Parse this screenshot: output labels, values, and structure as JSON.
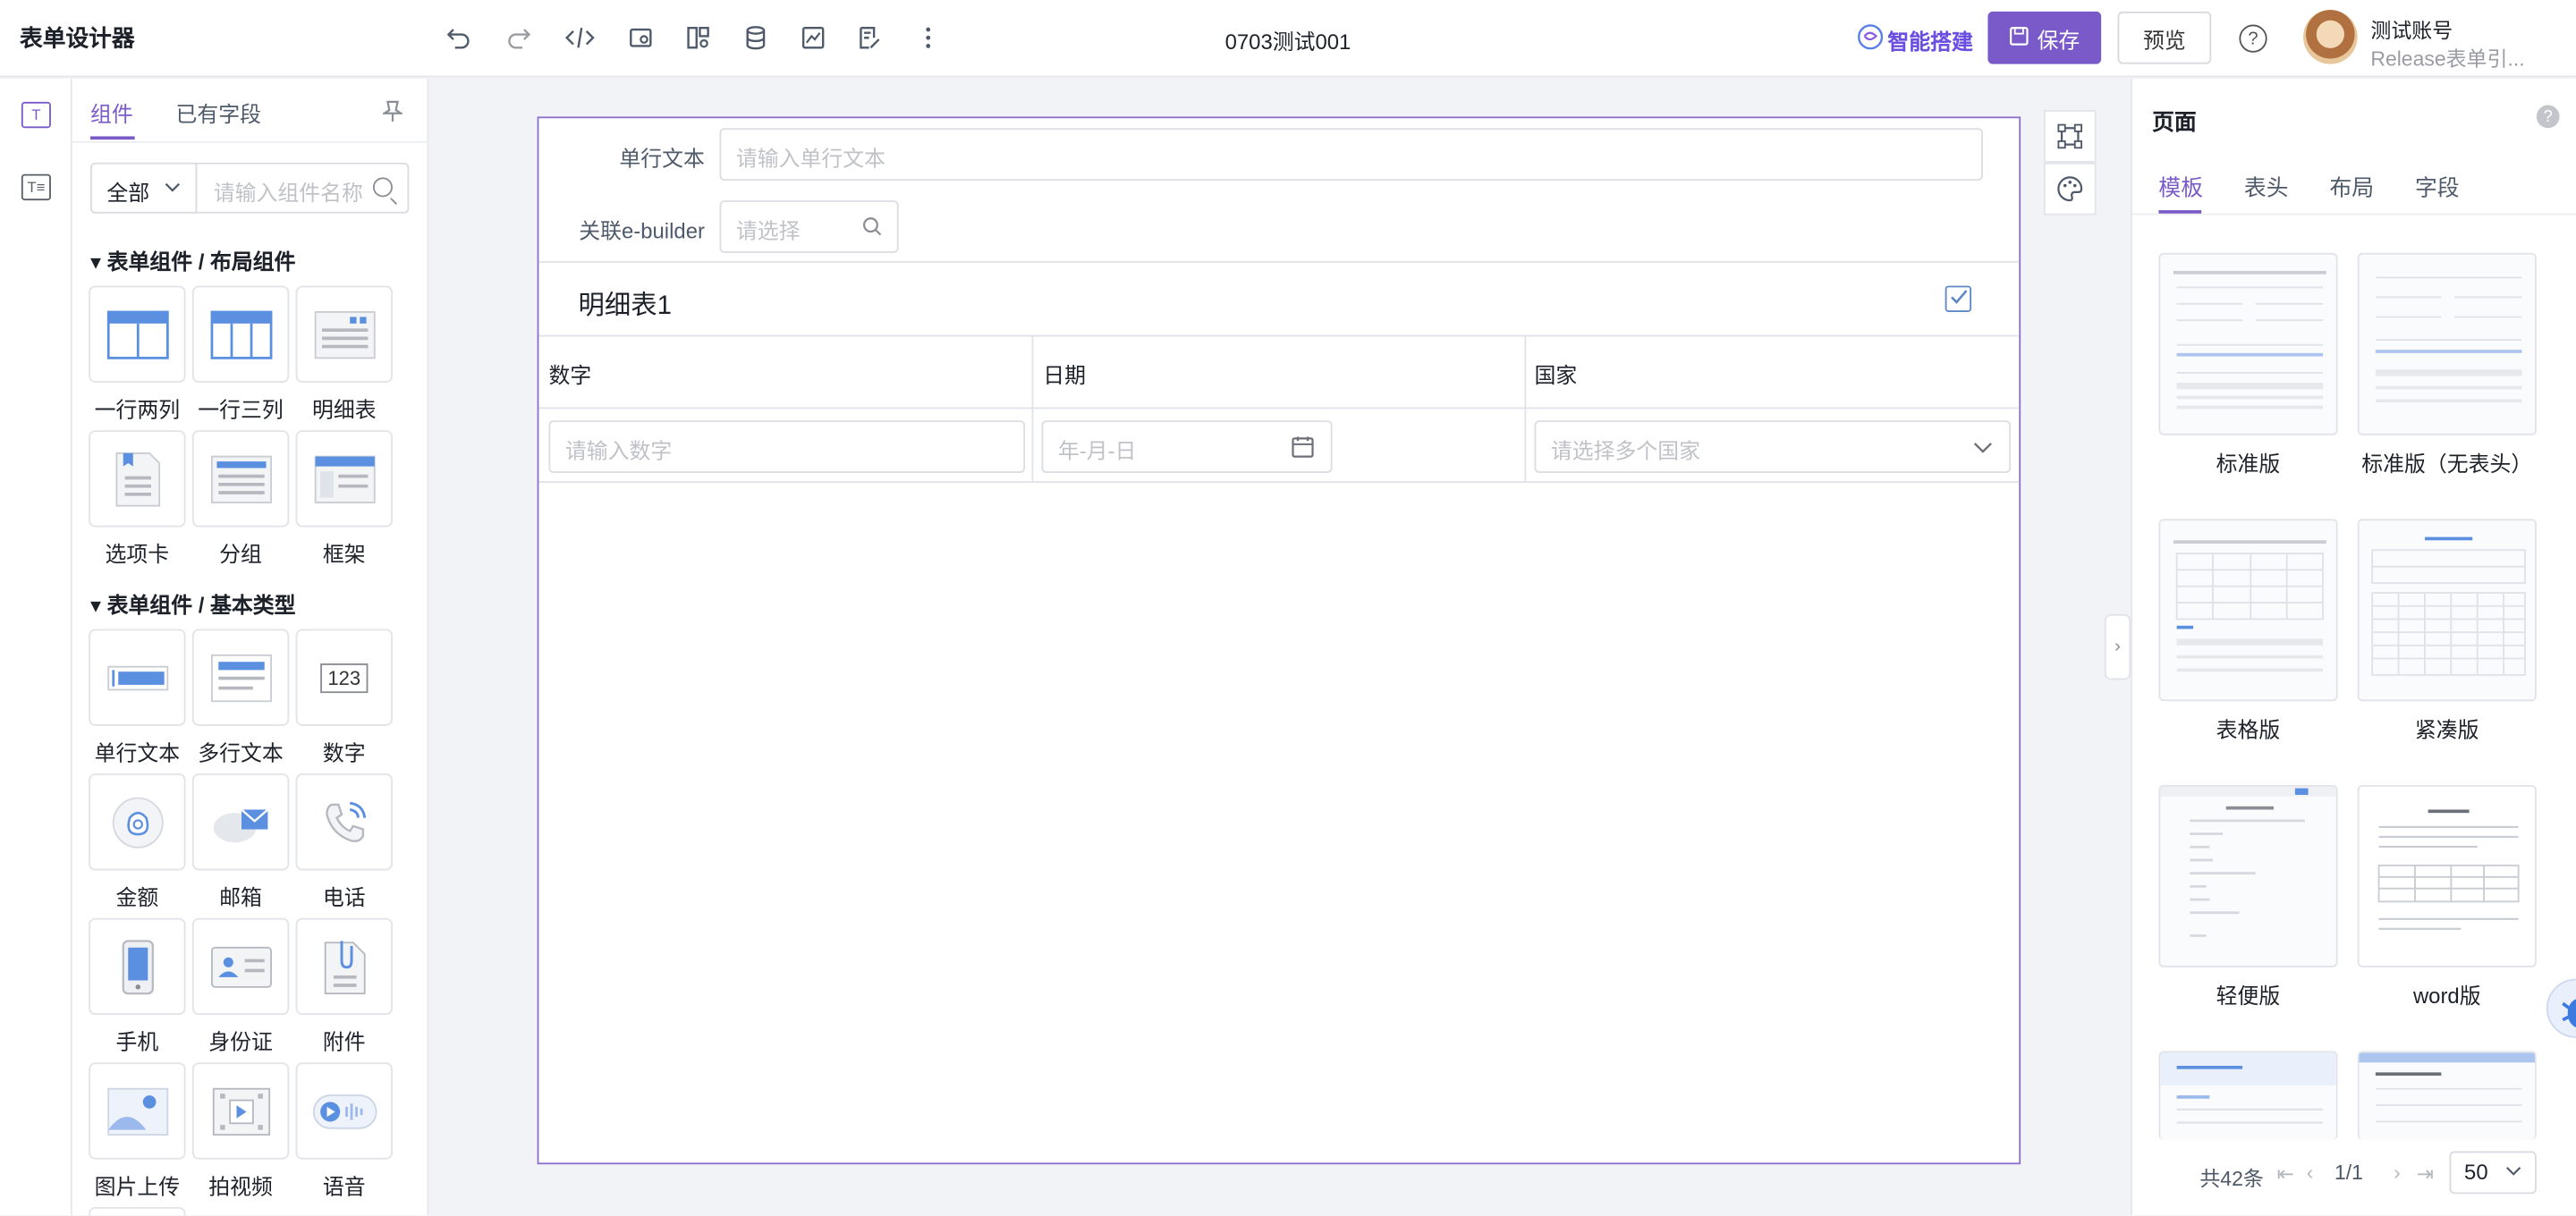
{
  "app": {
    "title": "表单设计器",
    "form_name": "0703测试001"
  },
  "toolbar": {
    "icons": [
      "undo-icon",
      "redo-icon",
      "code-icon",
      "print-icon",
      "layout-icon",
      "database-icon",
      "chart-icon",
      "edit-doc-icon",
      "more-icon"
    ],
    "ai_label": "智能搭建",
    "save_label": "保存",
    "preview_label": "预览",
    "help_glyph": "?"
  },
  "user": {
    "name": "测试账号",
    "subtitle": "Release表单引..."
  },
  "left_rail": {
    "icons": [
      "text-component-icon",
      "text-list-icon"
    ],
    "rail_top_glyph": "T",
    "rail_bottom_glyph": "T≡"
  },
  "left_panel": {
    "tabs": [
      "组件",
      "已有字段"
    ],
    "category": "全部",
    "search_placeholder": "请输入组件名称",
    "section1": "表单组件 / 布局组件",
    "section2": "表单组件 / 基本类型",
    "layout_components": [
      "一行两列",
      "一行三列",
      "明细表",
      "选项卡",
      "分组",
      "框架"
    ],
    "basic_components": [
      "单行文本",
      "多行文本",
      "数字",
      "金额",
      "邮箱",
      "电话",
      "手机",
      "身份证",
      "附件",
      "图片上传",
      "拍视频",
      "语音"
    ],
    "number_glyph": "123"
  },
  "canvas": {
    "field1_label": "单行文本",
    "field1_placeholder": "请输入单行文本",
    "field2_label": "关联e-builder",
    "field2_placeholder": "请选择",
    "detail_title": "明细表1",
    "columns": [
      "数字",
      "日期",
      "国家"
    ],
    "row_placeholders": [
      "请输入数字",
      "年-月-日",
      "请选择多个国家"
    ]
  },
  "right_panel": {
    "title": "页面",
    "help_glyph": "?",
    "tabs": [
      "模板",
      "表头",
      "布局",
      "字段"
    ],
    "templates": [
      "标准版",
      "标准版（无表头）",
      "表格版",
      "紧凑版",
      "轻便版",
      "word版"
    ],
    "pagination": {
      "total": "共42条",
      "page": "1/1",
      "page_size": "50"
    }
  },
  "colors": {
    "accent": "#7a5ac8",
    "ai": "#6b4fe0",
    "blue": "#5b8fe0"
  }
}
